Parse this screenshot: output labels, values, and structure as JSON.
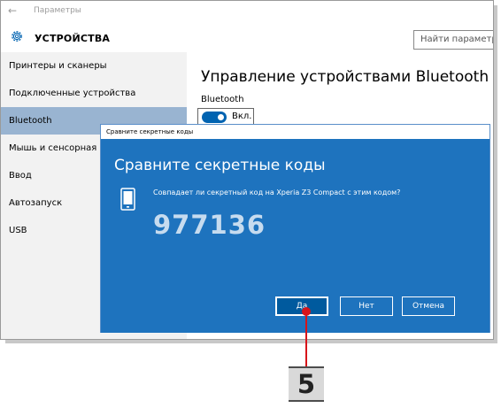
{
  "window": {
    "back_glyph": "←",
    "title": "Параметры"
  },
  "header": {
    "title": "УСТРОЙСТВА",
    "search_placeholder": "Найти параметр"
  },
  "sidebar": {
    "items": [
      {
        "label": "Принтеры и сканеры",
        "active": false
      },
      {
        "label": "Подключенные устройства",
        "active": false
      },
      {
        "label": "Bluetooth",
        "active": true
      },
      {
        "label": "Мышь и сенсорная панель",
        "active": false
      },
      {
        "label": "Ввод",
        "active": false
      },
      {
        "label": "Автозапуск",
        "active": false
      },
      {
        "label": "USB",
        "active": false
      }
    ]
  },
  "main": {
    "title": "Управление устройствами Bluetooth",
    "bluetooth_label": "Bluetooth",
    "toggle_state": "Вкл."
  },
  "dialog": {
    "window_title": "Сравните секретные коды",
    "heading": "Сравните секретные коды",
    "question": "Совпадает ли секретный код на Xperia Z3 Compact с этим кодом?",
    "code": "977136",
    "buttons": {
      "yes": "Да",
      "no": "Нет",
      "cancel": "Отмена"
    }
  },
  "annotation": {
    "step": "5"
  },
  "colors": {
    "accent": "#0063b1",
    "dialog_bg": "#1e73be",
    "sidebar_active": "#99b4d1",
    "pointer": "#d7141a"
  }
}
